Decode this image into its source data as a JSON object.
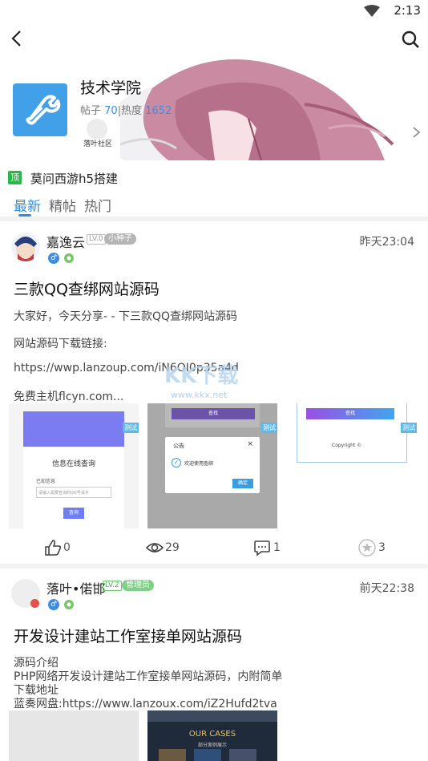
{
  "status_bar": {
    "time": "2:13"
  },
  "forum": {
    "title": "技术学院",
    "posts_label": "帖子",
    "posts_count": "70",
    "hot_label": "热度",
    "hot_count": "1652",
    "community_label": "落叶社区"
  },
  "pinned": {
    "badge": "顶",
    "title": "莫问西游h5搭建"
  },
  "tabs": [
    {
      "label": "最新",
      "active": true
    },
    {
      "label": "精帖",
      "active": false
    },
    {
      "label": "热门",
      "active": false
    }
  ],
  "posts": [
    {
      "author": "嘉逸云",
      "level": "LV.0",
      "role": "小种子",
      "time": "昨天23:04",
      "title": "三款QQ查绑网站源码",
      "lines": [
        "大家好，今天分享- - 下三款QQ查绑网站源码",
        "网站源码下载链接:",
        "https://wwp.lanzoup.com/iN6OI0p35a4d",
        "免费主机flcyn.com..."
      ],
      "thumbs": [
        {
          "tag": "测试",
          "heading": "信息在线查询",
          "label": "已知信息",
          "placeholder": "请输入需要查询的QQ号请手",
          "button": "查询"
        },
        {
          "tag": "测试",
          "button_top": "查找",
          "dialog_title": "公告",
          "dialog_close": "×",
          "dialog_text": "欢迎使用查绑",
          "dialog_button": "确定"
        },
        {
          "tag": "测试",
          "button_top": "查找",
          "footer": "Copyright ©"
        }
      ],
      "likes": "0",
      "views": "29",
      "comments": "1",
      "favorites": "3"
    },
    {
      "author": "落叶•偌邯",
      "level": "LV.2",
      "role": "管理员",
      "time": "前天22:38",
      "title": "开发设计建站工作室接单网站源码",
      "lines": [
        "源码介绍",
        "PHP网络开发设计建站工作室接单网站源码，内附简单",
        "下载地址",
        "蓝奏网盘:https://www.lanzoux.com/iZ2Hufd2tva"
      ],
      "thumb2_heading": "OUR CASES",
      "thumb2_sub": "部分案例展示"
    }
  ],
  "watermark": {
    "text": "KK下载",
    "sub": "www.kkx.net"
  },
  "colors": {
    "accent": "#2f8fdc",
    "pin_badge": "#2cb54a",
    "forum_icon": "#42a0e8"
  },
  "icons": [
    "wifi-icon",
    "back-arrow-icon",
    "search-icon",
    "wrench-icon",
    "chevron-right-icon",
    "like-icon",
    "view-icon",
    "comment-icon",
    "favorite-icon",
    "male-icon",
    "medal-icon"
  ]
}
